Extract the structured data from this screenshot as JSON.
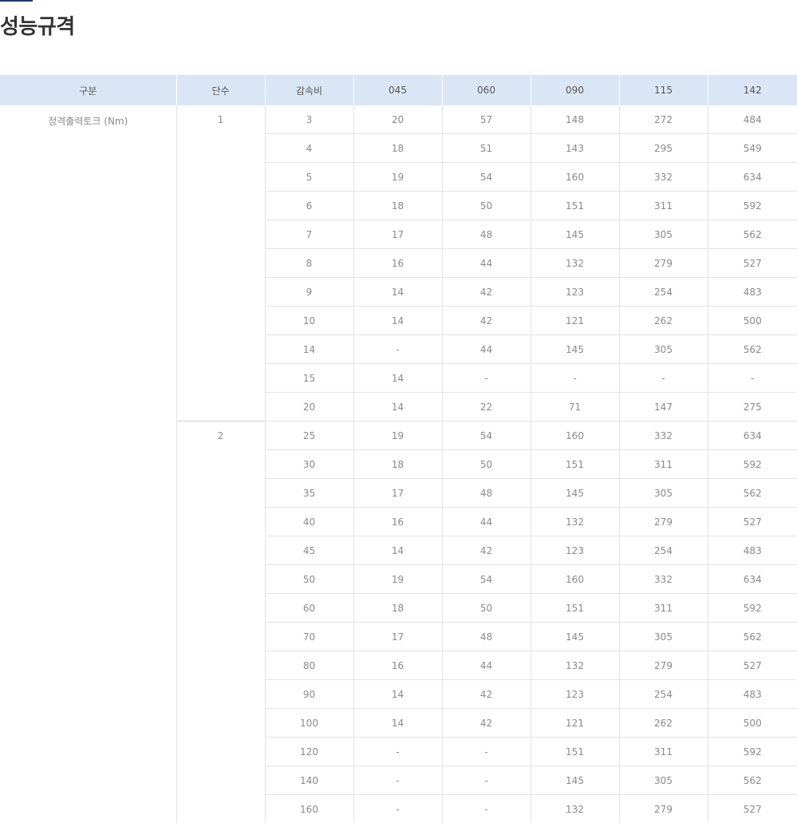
{
  "page": {
    "title": "성능규격"
  },
  "colors": {
    "accent": "#1e3a6e",
    "header_bg": "#dae6f6"
  },
  "table": {
    "headers": [
      "구분",
      "단수",
      "감속비",
      "045",
      "060",
      "090",
      "115",
      "142"
    ],
    "group_label": "정격출력토크 (Nm)",
    "stages": [
      {
        "label": "1",
        "rows": [
          [
            "3",
            "20",
            "57",
            "148",
            "272",
            "484"
          ],
          [
            "4",
            "18",
            "51",
            "143",
            "295",
            "549"
          ],
          [
            "5",
            "19",
            "54",
            "160",
            "332",
            "634"
          ],
          [
            "6",
            "18",
            "50",
            "151",
            "311",
            "592"
          ],
          [
            "7",
            "17",
            "48",
            "145",
            "305",
            "562"
          ],
          [
            "8",
            "16",
            "44",
            "132",
            "279",
            "527"
          ],
          [
            "9",
            "14",
            "42",
            "123",
            "254",
            "483"
          ],
          [
            "10",
            "14",
            "42",
            "121",
            "262",
            "500"
          ],
          [
            "14",
            "-",
            "44",
            "145",
            "305",
            "562"
          ],
          [
            "15",
            "14",
            "-",
            "-",
            "-",
            "-"
          ],
          [
            "20",
            "14",
            "22",
            "71",
            "147",
            "275"
          ]
        ]
      },
      {
        "label": "2",
        "rows": [
          [
            "25",
            "19",
            "54",
            "160",
            "332",
            "634"
          ],
          [
            "30",
            "18",
            "50",
            "151",
            "311",
            "592"
          ],
          [
            "35",
            "17",
            "48",
            "145",
            "305",
            "562"
          ],
          [
            "40",
            "16",
            "44",
            "132",
            "279",
            "527"
          ],
          [
            "45",
            "14",
            "42",
            "123",
            "254",
            "483"
          ],
          [
            "50",
            "19",
            "54",
            "160",
            "332",
            "634"
          ],
          [
            "60",
            "18",
            "50",
            "151",
            "311",
            "592"
          ],
          [
            "70",
            "17",
            "48",
            "145",
            "305",
            "562"
          ],
          [
            "80",
            "16",
            "44",
            "132",
            "279",
            "527"
          ],
          [
            "90",
            "14",
            "42",
            "123",
            "254",
            "483"
          ],
          [
            "100",
            "14",
            "42",
            "121",
            "262",
            "500"
          ],
          [
            "120",
            "-",
            "-",
            "151",
            "311",
            "592"
          ],
          [
            "140",
            "-",
            "-",
            "145",
            "305",
            "562"
          ],
          [
            "160",
            "-",
            "-",
            "132",
            "279",
            "527"
          ]
        ]
      }
    ]
  }
}
